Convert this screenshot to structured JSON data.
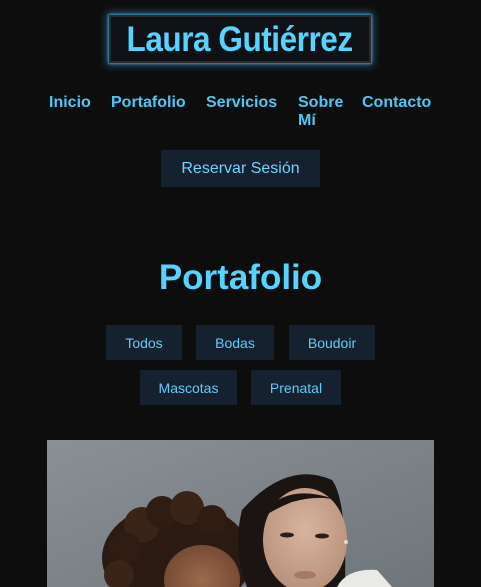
{
  "brand": {
    "name": "Laura Gutiérrez"
  },
  "nav": {
    "items": [
      {
        "label": "Inicio"
      },
      {
        "label": "Portafolio"
      },
      {
        "label": "Servicios"
      },
      {
        "label": "Sobre Mí"
      },
      {
        "label": "Contacto"
      }
    ]
  },
  "cta": {
    "label": "Reservar Sesión"
  },
  "portfolio": {
    "title": "Portafolio",
    "filters": [
      {
        "label": "Todos"
      },
      {
        "label": "Bodas"
      },
      {
        "label": "Boudoir"
      },
      {
        "label": "Mascotas"
      },
      {
        "label": "Prenatal"
      }
    ]
  },
  "colors": {
    "accent": "#56d3ff",
    "background": "#0d0d0e",
    "button_bg": "#15212f"
  }
}
